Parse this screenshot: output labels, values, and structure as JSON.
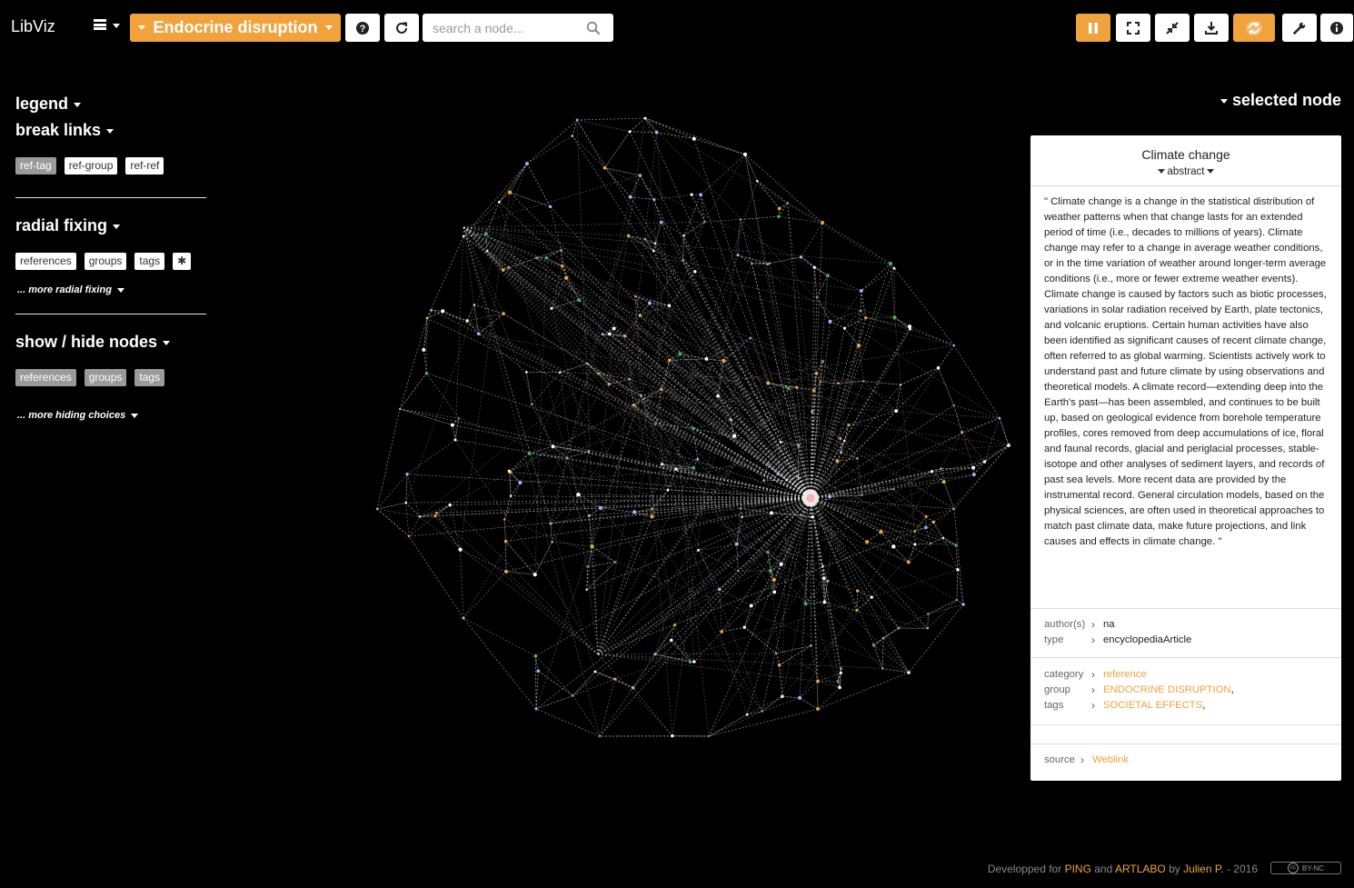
{
  "app": {
    "name": "LibViz"
  },
  "topbar": {
    "project_label": "Endocrine disruption",
    "search_placeholder": "search a node..."
  },
  "left_panel": {
    "legend_label": "legend",
    "break_links_label": "break links",
    "break_links_tags": [
      "ref-tag",
      "ref-group",
      "ref-ref"
    ],
    "radial_fixing_label": "radial fixing",
    "radial_fixing_tags": [
      "references",
      "groups",
      "tags",
      "✱"
    ],
    "more_radial_label": "... more radial fixing",
    "show_hide_label": "show / hide nodes",
    "show_hide_tags": [
      "references",
      "groups",
      "tags"
    ],
    "more_hiding_label": "... more hiding choices"
  },
  "selected": {
    "header_label": "selected node",
    "title": "Climate change",
    "subtitle": "abstract",
    "abstract": "\" Climate change is a change in the statistical distribution of weather patterns when that change lasts for an extended period of time (i.e., decades to millions of years). Climate change may refer to a change in average weather conditions, or in the time variation of weather around longer-term average conditions (i.e., more or fewer extreme weather events). Climate change is caused by factors such as biotic processes, variations in solar radiation received by Earth, plate tectonics, and volcanic eruptions. Certain human activities have also been identified as significant causes of recent climate change, often referred to as global warming. Scientists actively work to understand past and future climate by using observations and theoretical models. A climate record—extending deep into the Earth's past—has been assembled, and continues to be built up, based on geological evidence from borehole temperature profiles, cores removed from deep accumulations of ice, floral and faunal records, glacial and periglacial processes, stable-isotope and other analyses of sediment layers, and records of past sea levels. More recent data are provided by the instrumental record. General circulation models, based on the physical sciences, are often used in theoretical approaches to match past climate data, make future projections, and link causes and effects in climate change. \"",
    "authors_key": "author(s)",
    "authors": "na",
    "type_key": "type",
    "type": "encyclopediaArticle",
    "category_key": "category",
    "category": "reference",
    "group_key": "group",
    "group": "ENDOCRINE DISRUPTION",
    "tags_key": "tags",
    "tags": "SOCIETAL EFFECTS",
    "source_key": "source",
    "source": "Weblink"
  },
  "footer": {
    "prefix": "Developped for",
    "ping": "PING",
    "and": "and",
    "artlabo": "ARTLABO",
    "by": "by",
    "author": "Julien P.",
    "year": "- 2016",
    "license": "BY-NC",
    "cc": "cc"
  },
  "colors": {
    "accent": "#f0a33d",
    "background": "#000000",
    "node_green": "#4caf50",
    "node_orange": "#f0a33d",
    "link": "#dddddd"
  }
}
